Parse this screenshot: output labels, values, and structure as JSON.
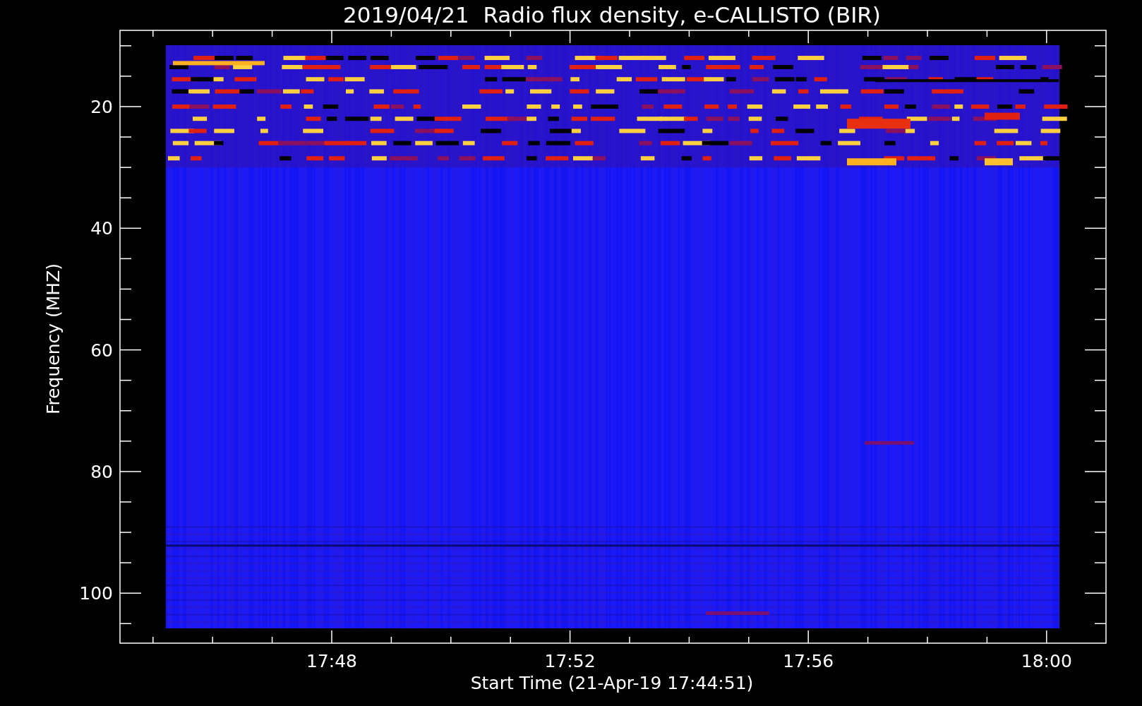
{
  "title": "2019/04/21  Radio flux density, e-CALLISTO (BIR)",
  "y_axis": {
    "label": "Frequency (MHZ)",
    "ticks": [
      "20",
      "40",
      "60",
      "80",
      "100"
    ]
  },
  "x_axis": {
    "label": "Start Time (21-Apr-19 17:44:51)",
    "ticks": [
      "17:48",
      "17:52",
      "17:56",
      "18:00"
    ]
  }
}
